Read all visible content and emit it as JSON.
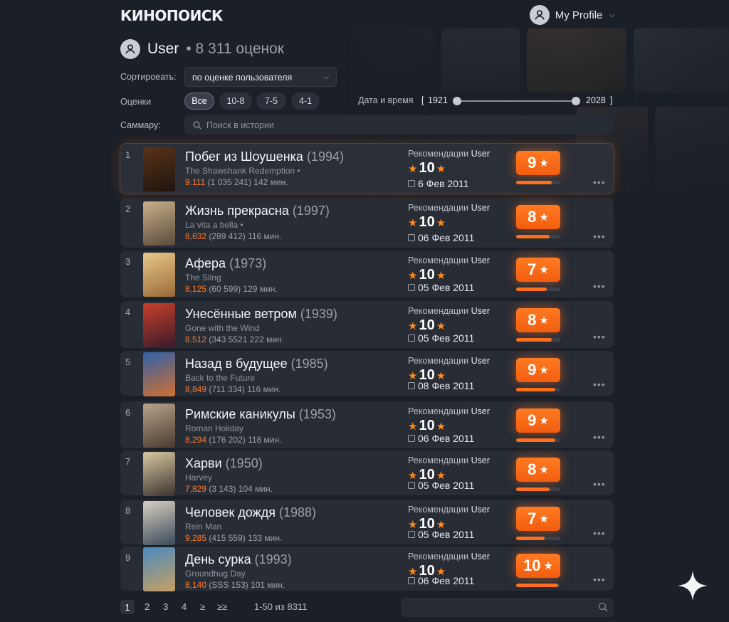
{
  "app": {
    "logo": "КИНОПОИСК"
  },
  "profile": {
    "label": "My Profile"
  },
  "user": {
    "name": "User",
    "count": "• 8 311 оценок"
  },
  "controls": {
    "sort_label": "Сортироеать:",
    "sort_value": "по оценке пользователя",
    "ratings_label": "Оценки",
    "rating_chips": [
      "Все",
      "10-8",
      "7-5",
      "4-1"
    ],
    "date_label": "Дата и время",
    "date_open": "[",
    "date_from": "1921",
    "date_to": "2028",
    "date_close": "]",
    "summary_label": "Саммару:",
    "search_placeholder": "Поиск в истории"
  },
  "colors": {
    "accent": "#ff7a22",
    "rating": "#ff7a2e",
    "background": "#1b1f27"
  },
  "movies": [
    {
      "num": "1",
      "title": "Побег из Шоушенка",
      "year": "(1994)",
      "orig": "The Shawshank Redemption •",
      "rating": "9.111",
      "votes": "(1 035 241) 142 мин.",
      "rec": "Рекомендации",
      "rec_user": "User",
      "rec_score": "10",
      "date": "6 Фев 2011",
      "score": "9",
      "score_fill": 0.8
    },
    {
      "num": "2",
      "title": "Жизнь прекрасна",
      "year": "(1997)",
      "orig": "La vita a bella •",
      "rating": "8,632",
      "votes": "(289 412) 116 мин.",
      "rec": "Рекомендации",
      "rec_user": "User",
      "rec_score": "10",
      "date": "06 Фев 2011",
      "score": "8",
      "score_fill": 0.75
    },
    {
      "num": "3",
      "title": "Афера",
      "year": "(1973)",
      "orig": "The Sling",
      "rating": "8,125",
      "votes": "(60 599) 129 мин.",
      "rec": "Рекомендации",
      "rec_user": "User",
      "rec_score": "10",
      "date": "05 Фев 2011",
      "score": "7",
      "score_fill": 0.7
    },
    {
      "num": "4",
      "title": "Унесённые ветром",
      "year": "(1939)",
      "orig": "Gone with the Wind",
      "rating": "8.512",
      "votes": "(343 5521 222 мин.",
      "rec": "Рекомендации",
      "rec_user": "User",
      "rec_score": "10",
      "date": "05 Фев 2011",
      "score": "8",
      "score_fill": 0.8
    },
    {
      "num": "5",
      "title": "Назад в будущее",
      "year": "(1985)",
      "orig": "Back to the Future",
      "rating": "8,849",
      "votes": "(711 334) 116 мин.",
      "rec": "Рекомендации",
      "rec_user": "User",
      "rec_score": "10",
      "date": "08 Фев 2011",
      "score": "9",
      "score_fill": 0.88
    },
    {
      "num": "6",
      "title": "Римские каникулы",
      "year": "(1953)",
      "orig": "Roman Hoiiday",
      "rating": "8,294",
      "votes": "(176 202) 118 мин.",
      "rec": "Рекомендации",
      "rec_user": "User",
      "rec_score": "10",
      "date": "06 Фев 2011",
      "score": "9",
      "score_fill": 0.88
    },
    {
      "num": "7",
      "title": "Харви",
      "year": "(1950)",
      "orig": "Harvey",
      "rating": "7,829",
      "votes": "(3 143) 104 мин.",
      "rec": "Рекомендации",
      "rec_user": "User",
      "rec_score": "10",
      "date": "05 Фев 2011",
      "score": "8",
      "score_fill": 0.75
    },
    {
      "num": "8",
      "title": "Человек дождя",
      "year": "(1988)",
      "orig": "Rein Man",
      "rating": "9,285",
      "votes": "(415 559) 133 мин.",
      "rec": "Рекомендации",
      "rec_user": "User",
      "rec_score": "10",
      "date": "05 Фев 2011",
      "score": "7",
      "score_fill": 0.65
    },
    {
      "num": "9",
      "title": "День сурка",
      "year": "(1993)",
      "orig": "Groundhug Day",
      "rating": "8,140",
      "votes": "(SSS 153) 101 мин.",
      "rec": "Рекомендации",
      "rec_user": "User",
      "rec_score": "10",
      "date": "06 Фев 2011",
      "score": "10",
      "score_fill": 0.95
    }
  ],
  "pagination": {
    "pages": [
      "1",
      "2",
      "3",
      "4",
      "≥",
      "≥≥"
    ],
    "range": "1-50 из 8311"
  },
  "icons": {
    "profile": "user-icon",
    "search": "search-icon",
    "more": "more-icon",
    "calendar": "calendar-icon",
    "star": "star-icon",
    "sparkle": "sparkle-icon"
  }
}
